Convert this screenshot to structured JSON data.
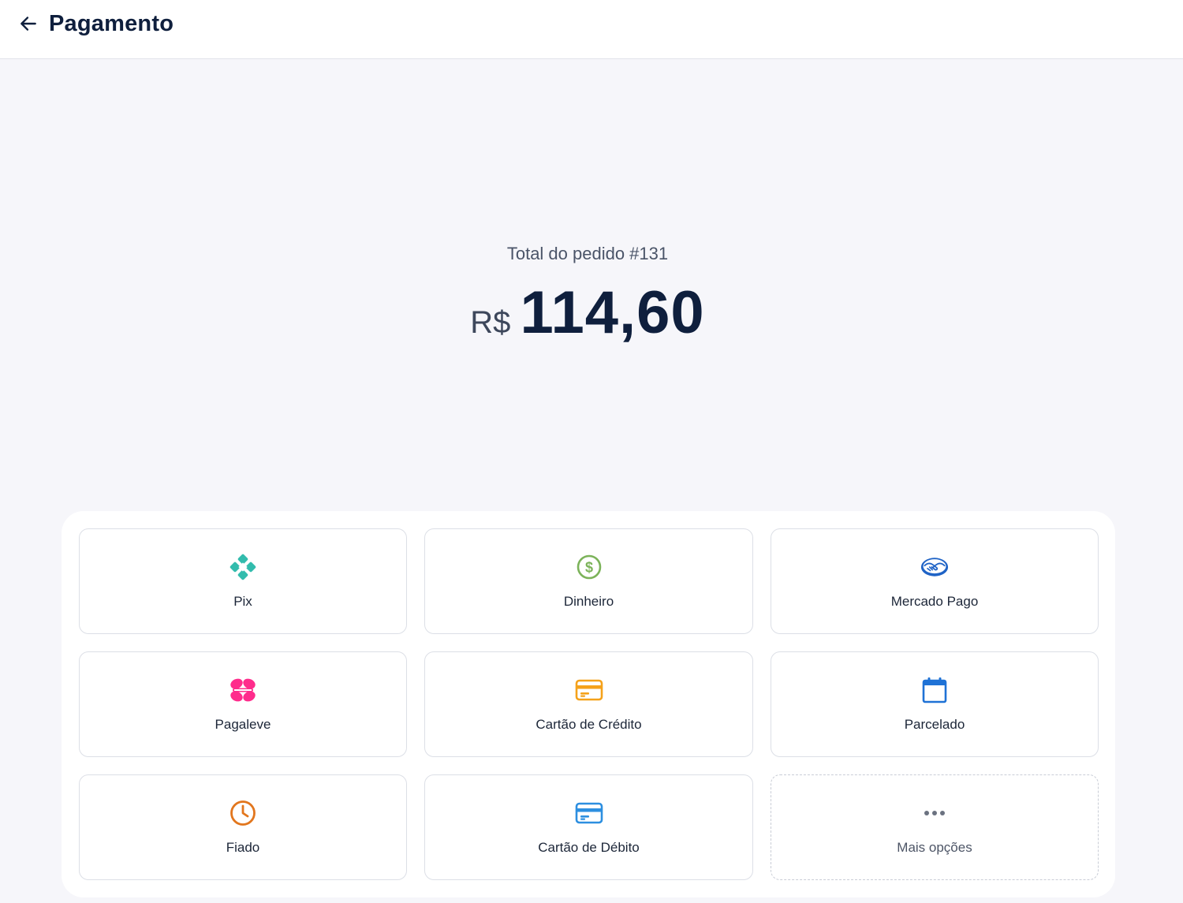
{
  "header": {
    "title": "Pagamento",
    "back_icon": "arrow-left-icon"
  },
  "order": {
    "total_label": "Total do pedido #131",
    "currency": "R$",
    "amount": "114,60"
  },
  "methods": [
    {
      "label": "Pix",
      "icon": "pix-icon",
      "color": "#32bcad"
    },
    {
      "label": "Dinheiro",
      "icon": "dollar-circle-icon",
      "color": "#7cb35a"
    },
    {
      "label": "Mercado Pago",
      "icon": "mercado-pago-handshake-icon",
      "color": "#1f63c6"
    },
    {
      "label": "Pagaleve",
      "icon": "pagaleve-icon",
      "color": "#ff2c8c"
    },
    {
      "label": "Cartão de Crédito",
      "icon": "credit-card-icon",
      "color": "#f5a21b"
    },
    {
      "label": "Parcelado",
      "icon": "calendar-icon",
      "color": "#1f72d6"
    },
    {
      "label": "Fiado",
      "icon": "clock-icon",
      "color": "#e2761d"
    },
    {
      "label": "Cartão de Débito",
      "icon": "debit-card-icon",
      "color": "#2d8fe0"
    },
    {
      "label": "Mais opções",
      "icon": "more-dots-icon",
      "color": "#6b7280"
    }
  ]
}
